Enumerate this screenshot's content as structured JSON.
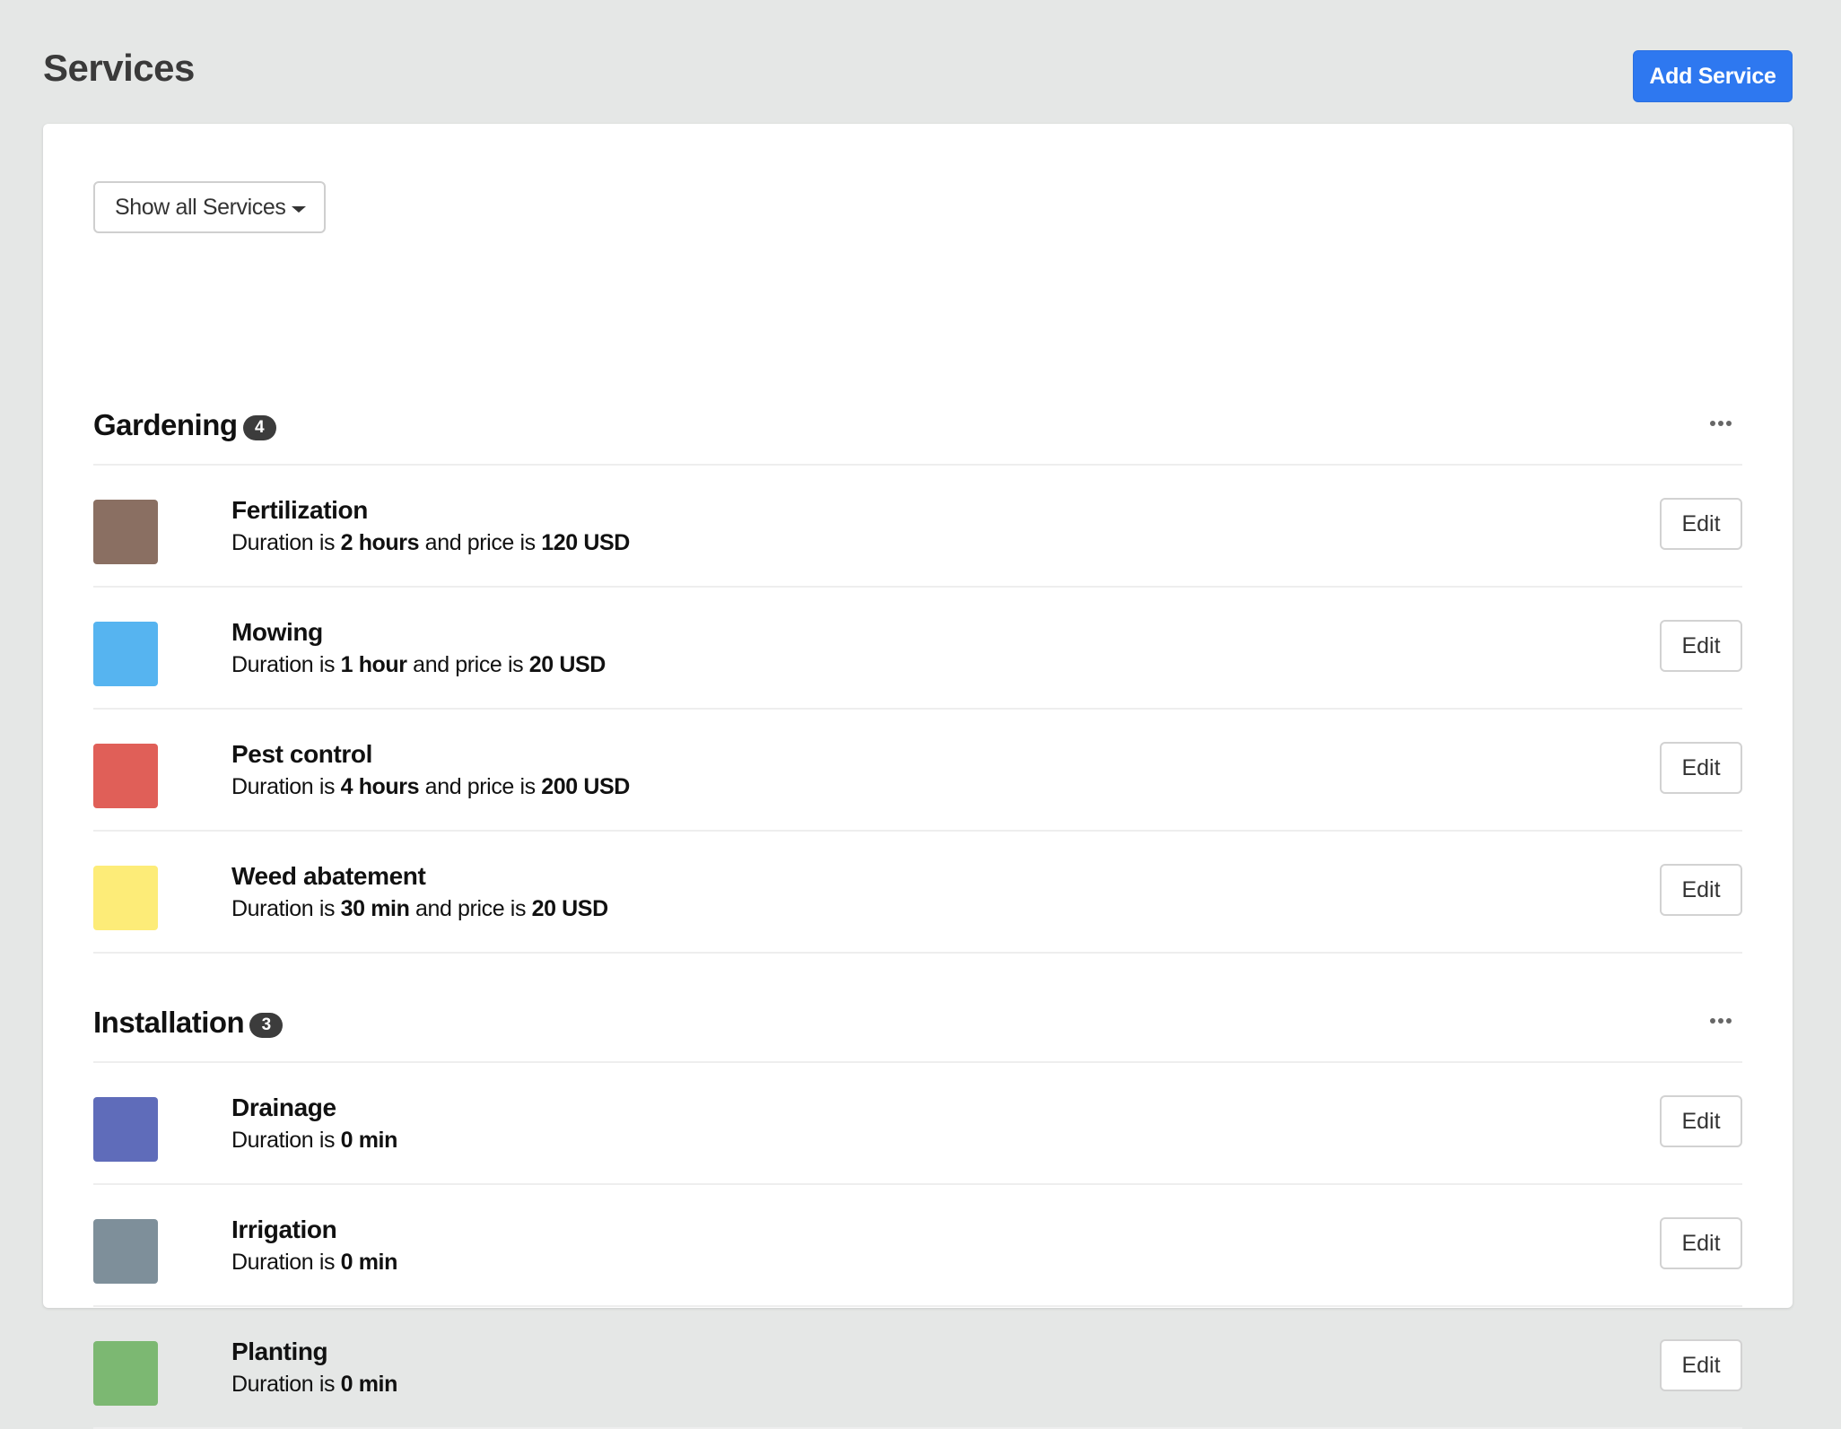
{
  "header": {
    "title": "Services",
    "add_button_label": "Add Service",
    "accent_color": "#2e78f0"
  },
  "filter": {
    "dropdown_label": "Show all Services",
    "dropdown_icon": "caret-down-icon"
  },
  "sections": [
    {
      "title": "Gardening",
      "count": "4",
      "menu_icon": "more-horizontal-icon",
      "services": [
        {
          "name": "Fertilization",
          "color": "#8a6f62",
          "desc_prefix": "Duration is ",
          "duration": "2 hours",
          "desc_mid": " and price is ",
          "price": "120 USD",
          "edit_label": "Edit"
        },
        {
          "name": "Mowing",
          "color": "#56b4f0",
          "desc_prefix": "Duration is ",
          "duration": "1 hour",
          "desc_mid": " and price is ",
          "price": "20 USD",
          "edit_label": "Edit"
        },
        {
          "name": "Pest control",
          "color": "#e05f58",
          "desc_prefix": "Duration is ",
          "duration": "4 hours",
          "desc_mid": " and price is ",
          "price": "200 USD",
          "edit_label": "Edit"
        },
        {
          "name": "Weed abatement",
          "color": "#fdec78",
          "desc_prefix": "Duration is ",
          "duration": "30 min",
          "desc_mid": " and price is ",
          "price": "20 USD",
          "edit_label": "Edit"
        }
      ]
    },
    {
      "title": "Installation",
      "count": "3",
      "menu_icon": "more-horizontal-icon",
      "services": [
        {
          "name": "Drainage",
          "color": "#5f6cba",
          "desc_prefix": "Duration is ",
          "duration": "0 min",
          "desc_mid": "",
          "price": "",
          "edit_label": "Edit"
        },
        {
          "name": "Irrigation",
          "color": "#7e8f9a",
          "desc_prefix": "Duration is ",
          "duration": "0 min",
          "desc_mid": "",
          "price": "",
          "edit_label": "Edit"
        },
        {
          "name": "Planting",
          "color": "#7cb872",
          "desc_prefix": "Duration is ",
          "duration": "0 min",
          "desc_mid": "",
          "price": "",
          "edit_label": "Edit"
        }
      ]
    }
  ]
}
